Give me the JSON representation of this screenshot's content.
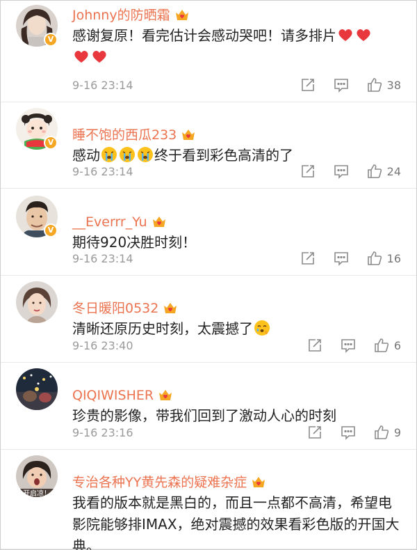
{
  "comments": [
    {
      "username": "Johnny的防晒霜",
      "text_parts": [
        "感谢复原！看完估计会感动哭吧！请多排片"
      ],
      "time": "9-16 23:14",
      "likes": "38"
    },
    {
      "username": "睡不饱的西瓜233",
      "text_before": "感动",
      "text_after": "终于看到彩色高清的了",
      "time": "9-16 23:14",
      "likes": "24"
    },
    {
      "username": "__Everrr_Yu",
      "text": "期待920决胜时刻！",
      "time": "9-16 23:14",
      "likes": "16"
    },
    {
      "username": "冬日暖阳0532",
      "text": "清晰还原历史时刻，太震撼了",
      "time": "9-16 23:40",
      "likes": "6"
    },
    {
      "username": "QIQIWISHER",
      "text": "珍贵的影像，带我们回到了激动人心的时刻",
      "time": "9-16 23:16",
      "likes": "9"
    },
    {
      "username": "专治各种YY黄先森的疑难杂症",
      "text": "我看的版本就是黑白的，而且一点都不高清，希望电影院能够排IMAX，绝对震撼的效果看彩色版的开国大典。"
    }
  ],
  "colors": {
    "username": "#eb7350",
    "verified_badge": "#f5a623",
    "heart": "#e8383d",
    "icon_gray": "#8a8a8a"
  },
  "icons": {
    "forward": "share-edit-icon",
    "comment": "comment-bubble-icon",
    "like": "thumb-up-icon",
    "member": "crown-heart-icon",
    "verified": "v-badge"
  },
  "avatar_captions": {
    "comment_6": "开启凉！"
  }
}
